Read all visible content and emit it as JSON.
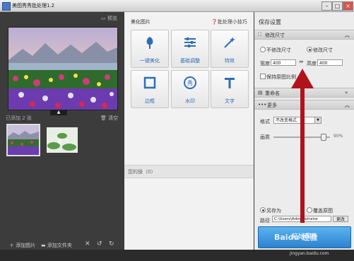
{
  "window": {
    "title": "美图秀秀批处理1.2",
    "minimize": "–",
    "maximize": "□",
    "close": "×"
  },
  "left": {
    "preview_label": "预览",
    "added_label": "已添加 2 张",
    "clear_label": "清空",
    "footer": {
      "add_image": "添加图片",
      "add_folder": "添加文件夹"
    }
  },
  "center": {
    "section_title": "美化图片",
    "help_link": "批处理小技巧",
    "tools": [
      {
        "label": "一键美化",
        "icon": "tulip-icon"
      },
      {
        "label": "基础调整",
        "icon": "sliders-icon"
      },
      {
        "label": "特效",
        "icon": "magic-wand-icon"
      },
      {
        "label": "边框",
        "icon": "frame-icon"
      },
      {
        "label": "水印",
        "icon": "watermark-icon"
      },
      {
        "label": "文字",
        "icon": "text-icon"
      }
    ],
    "ops_label": "您的操（0）"
  },
  "right": {
    "title": "保存设置",
    "size_section": "修改尺寸",
    "no_resize": "不修改尺寸",
    "resize": "修改尺寸",
    "width_label": "宽度",
    "width_value": "400",
    "height_label": "高度",
    "height_value": "400",
    "keep_ratio": "保持原图比例",
    "rename_section": "重命名",
    "more_section": "更多",
    "format_label": "格式",
    "format_value": "不改变格式",
    "quality_label": "画质",
    "quality_value": "90%",
    "save_as": "另存为",
    "overwrite": "覆盖原图",
    "path_label": "路径",
    "path_value": "C:\\Users\\Administrator",
    "change_button": "更改",
    "start_button": "开始保存"
  },
  "watermark": {
    "brand": "Baidu 经验",
    "url": "jingyan.baidu.com"
  },
  "colors": {
    "accent": "#2d82cf",
    "arrow": "#b0131c",
    "tool_text": "#2d6db7"
  }
}
